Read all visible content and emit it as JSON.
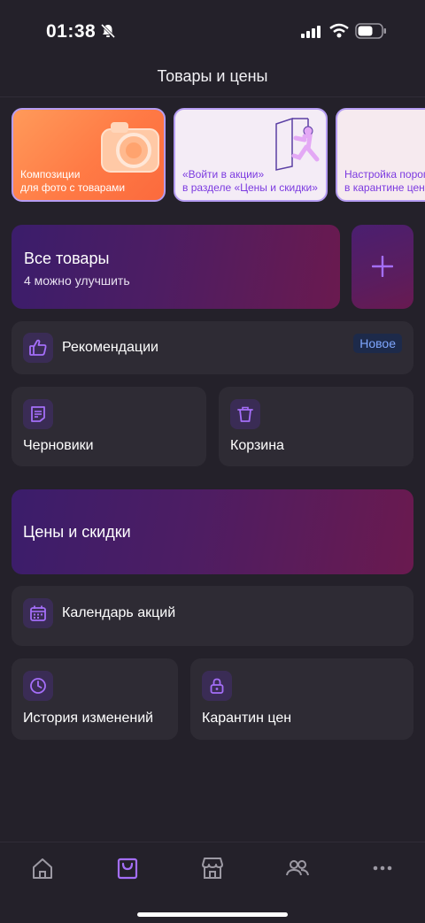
{
  "status": {
    "time": "01:38"
  },
  "header": {
    "title": "Товары и цены"
  },
  "stories": [
    {
      "label_line1": "Композиции",
      "label_line2": "для фото с товарами"
    },
    {
      "label_line1": "«Войти в акции»",
      "label_line2": "в разделе «Цены и скидки»"
    },
    {
      "label_line1": "Настройка порога",
      "label_line2": "в карантине цен"
    }
  ],
  "all_goods": {
    "title": "Все товары",
    "subtitle": "4 можно улучшить"
  },
  "recommendations": {
    "label": "Рекомендации",
    "badge": "Новое"
  },
  "drafts": {
    "label": "Черновики"
  },
  "trash": {
    "label": "Корзина"
  },
  "prices": {
    "title": "Цены и скидки"
  },
  "calendar": {
    "label": "Календарь акций"
  },
  "history": {
    "label": "История изменений"
  },
  "quarantine": {
    "label": "Карантин цен"
  },
  "tabbar": {
    "items": [
      {
        "icon": "home-icon"
      },
      {
        "icon": "bag-icon",
        "active": true
      },
      {
        "icon": "store-icon"
      },
      {
        "icon": "people-icon"
      },
      {
        "icon": "more-icon"
      }
    ]
  },
  "colors": {
    "accent": "#a46ef8",
    "background": "#24212a",
    "card": "#2e2b34",
    "badge_text": "#7fa7ff"
  }
}
